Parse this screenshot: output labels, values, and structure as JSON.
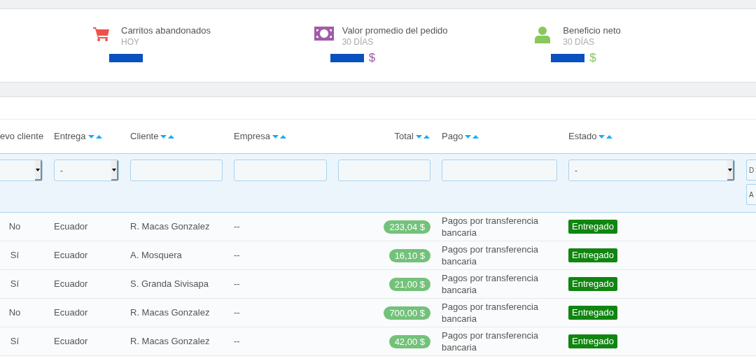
{
  "kpis": [
    {
      "kind": "cart",
      "title": "Carritos abandonados",
      "period": "HOY",
      "color": "#f0504a",
      "redacted": true
    },
    {
      "kind": "banknote",
      "title": "Valor promedio del pedido",
      "period": "30 DÍAS",
      "value": "$",
      "color": "#a25ba9",
      "redacted": true
    },
    {
      "kind": "person",
      "title": "Beneficio neto",
      "period": "30 DÍAS",
      "value": "$",
      "color": "#8ac75c",
      "redacted": true
    }
  ],
  "table": {
    "columns": [
      {
        "label": "evo cliente",
        "sortable": false,
        "filter": {
          "kind": "select"
        }
      },
      {
        "label": "Entrega",
        "sortable": true,
        "filter": {
          "kind": "select",
          "value": "-"
        }
      },
      {
        "label": "Cliente",
        "sortable": true,
        "filter": {
          "kind": "text"
        }
      },
      {
        "label": "Empresa",
        "sortable": true,
        "filter": {
          "kind": "text"
        }
      },
      {
        "label": "Total",
        "sortable": true,
        "filter": {
          "kind": "text"
        }
      },
      {
        "label": "Pago",
        "sortable": true,
        "filter": {
          "kind": "text"
        }
      },
      {
        "label": "Estado",
        "sortable": true,
        "filter": {
          "kind": "select",
          "value": "-"
        }
      },
      {
        "filter": {
          "kind": "dates",
          "fields": [
            {
              "placeholder": "D"
            },
            {
              "placeholder": "A"
            }
          ]
        }
      }
    ],
    "rows": [
      {
        "new_client": "No",
        "delivery": "Ecuador",
        "client": "R. Macas Gonzalez",
        "company": "--",
        "total": "233,04 $",
        "payment": "Pagos por transferencia bancaria",
        "status": "Entregado"
      },
      {
        "new_client": "Sí",
        "delivery": "Ecuador",
        "client": "A. Mosquera",
        "company": "--",
        "total": "16,10 $",
        "payment": "Pagos por transferencia bancaria",
        "status": "Entregado"
      },
      {
        "new_client": "Sí",
        "delivery": "Ecuador",
        "client": "S. Granda Sivisapa",
        "company": "--",
        "total": "21,00 $",
        "payment": "Pagos por transferencia bancaria",
        "status": "Entregado"
      },
      {
        "new_client": "No",
        "delivery": "Ecuador",
        "client": "R. Macas Gonzalez",
        "company": "--",
        "total": "700,00 $",
        "payment": "Pagos por transferencia bancaria",
        "status": "Entregado"
      },
      {
        "new_client": "Sí",
        "delivery": "Ecuador",
        "client": "R. Macas Gonzalez",
        "company": "--",
        "total": "42,00 $",
        "payment": "Pagos por transferencia bancaria",
        "status": "Entregado"
      }
    ]
  }
}
